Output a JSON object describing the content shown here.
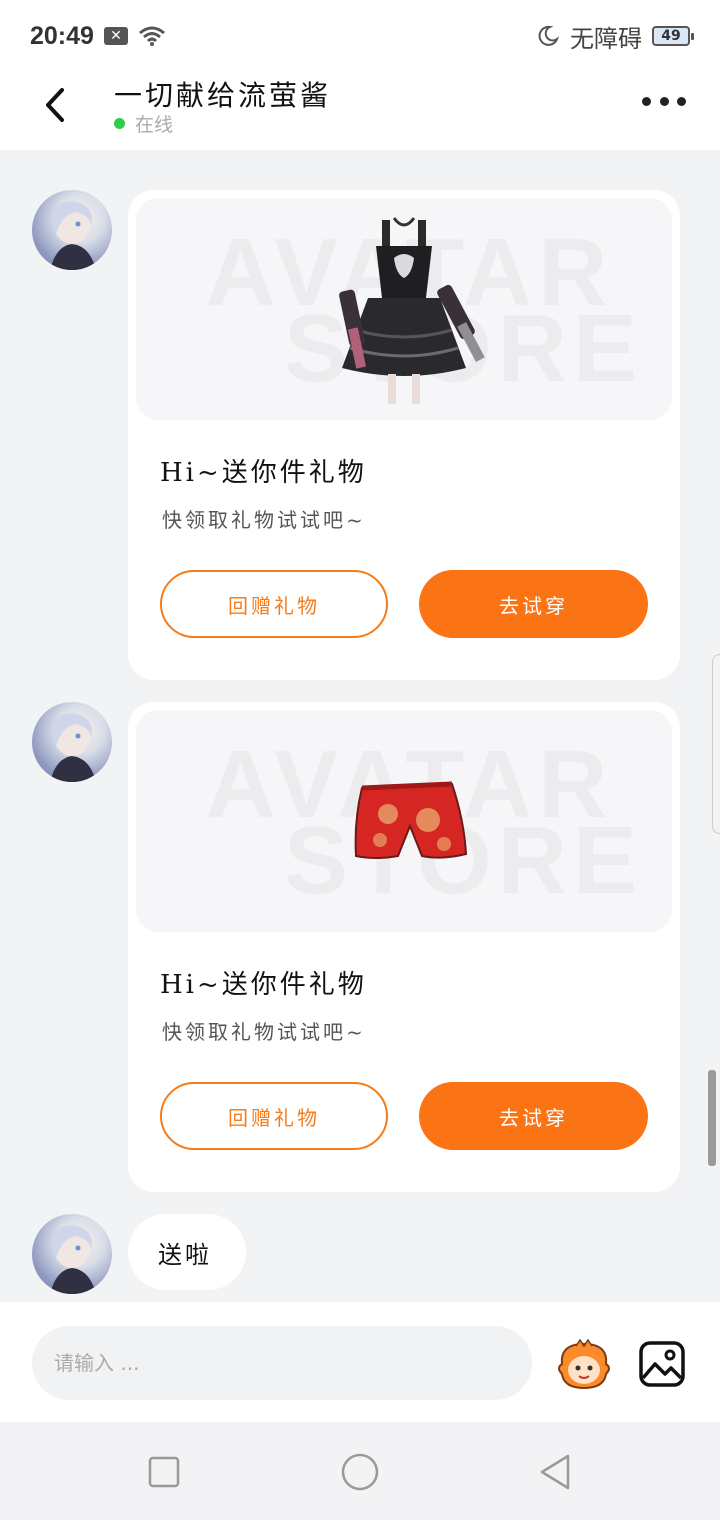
{
  "status_bar": {
    "time": "20:49",
    "accessibility_label": "无障碍",
    "battery_level": "49",
    "battery_percent": 49
  },
  "header": {
    "title": "一切献给流萤酱",
    "status_text": "在线",
    "status_color": "#2fce4a"
  },
  "messages": [
    {
      "type": "gift_card",
      "item": "black-dress",
      "watermark_line1": "AVATAR",
      "watermark_line2": "STORE",
      "title": "Hi~送你件礼物",
      "subtitle": "快领取礼物试试吧~",
      "return_gift_label": "回赠礼物",
      "try_on_label": "去试穿"
    },
    {
      "type": "gift_card",
      "item": "red-shorts",
      "watermark_line1": "AVATAR",
      "watermark_line2": "STORE",
      "title": "Hi~送你件礼物",
      "subtitle": "快领取礼物试试吧~",
      "return_gift_label": "回赠礼物",
      "try_on_label": "去试穿"
    },
    {
      "type": "text",
      "text": "送啦"
    }
  ],
  "input_bar": {
    "placeholder": "请输入 ..."
  },
  "colors": {
    "accent": "#fa7415",
    "background": "#f2f3f5"
  },
  "icons": [
    "back-arrow-icon",
    "more-icon",
    "emoji-mascot-icon",
    "image-icon",
    "nav-recent-icon",
    "nav-home-icon",
    "nav-back-icon"
  ]
}
